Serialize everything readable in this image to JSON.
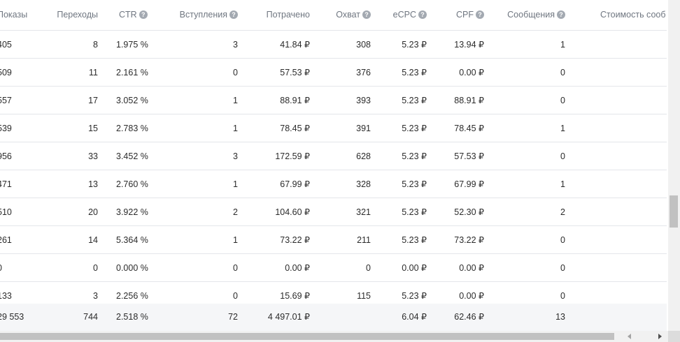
{
  "headers": {
    "shows": "Показы",
    "clicks": "Переходы",
    "ctr": "CTR",
    "joins": "Вступления",
    "spent": "Потрачено",
    "reach": "Охват",
    "ecpc": "eCPC",
    "cpf": "CPF",
    "messages": "Сообщения",
    "cost": "Стоимость сооб"
  },
  "help_icon": "question-circle-icon",
  "help_glyph": "?",
  "rows": [
    {
      "shows": "405",
      "clicks": "8",
      "ctr": "1.975 %",
      "joins": "3",
      "spent": "41.84 ₽",
      "reach": "308",
      "ecpc": "5.23 ₽",
      "cpf": "13.94 ₽",
      "messages": "1"
    },
    {
      "shows": "509",
      "clicks": "11",
      "ctr": "2.161 %",
      "joins": "0",
      "spent": "57.53 ₽",
      "reach": "376",
      "ecpc": "5.23 ₽",
      "cpf": "0.00 ₽",
      "messages": "0"
    },
    {
      "shows": "557",
      "clicks": "17",
      "ctr": "3.052 %",
      "joins": "1",
      "spent": "88.91 ₽",
      "reach": "393",
      "ecpc": "5.23 ₽",
      "cpf": "88.91 ₽",
      "messages": "0"
    },
    {
      "shows": "539",
      "clicks": "15",
      "ctr": "2.783 %",
      "joins": "1",
      "spent": "78.45 ₽",
      "reach": "391",
      "ecpc": "5.23 ₽",
      "cpf": "78.45 ₽",
      "messages": "1"
    },
    {
      "shows": "956",
      "clicks": "33",
      "ctr": "3.452 %",
      "joins": "3",
      "spent": "172.59 ₽",
      "reach": "628",
      "ecpc": "5.23 ₽",
      "cpf": "57.53 ₽",
      "messages": "0"
    },
    {
      "shows": "471",
      "clicks": "13",
      "ctr": "2.760 %",
      "joins": "1",
      "spent": "67.99 ₽",
      "reach": "328",
      "ecpc": "5.23 ₽",
      "cpf": "67.99 ₽",
      "messages": "1"
    },
    {
      "shows": "510",
      "clicks": "20",
      "ctr": "3.922 %",
      "joins": "2",
      "spent": "104.60 ₽",
      "reach": "321",
      "ecpc": "5.23 ₽",
      "cpf": "52.30 ₽",
      "messages": "2"
    },
    {
      "shows": "261",
      "clicks": "14",
      "ctr": "5.364 %",
      "joins": "1",
      "spent": "73.22 ₽",
      "reach": "211",
      "ecpc": "5.23 ₽",
      "cpf": "73.22 ₽",
      "messages": "0"
    },
    {
      "shows": "0",
      "clicks": "0",
      "ctr": "0.000 %",
      "joins": "0",
      "spent": "0.00 ₽",
      "reach": "0",
      "ecpc": "0.00 ₽",
      "cpf": "0.00 ₽",
      "messages": "0"
    },
    {
      "shows": "133",
      "clicks": "3",
      "ctr": "2.256 %",
      "joins": "0",
      "spent": "15.69 ₽",
      "reach": "115",
      "ecpc": "5.23 ₽",
      "cpf": "0.00 ₽",
      "messages": "0"
    }
  ],
  "totals": {
    "shows": "29 553",
    "clicks": "744",
    "ctr": "2.518 %",
    "joins": "72",
    "spent": "4 497.01 ₽",
    "reach": "",
    "ecpc": "6.04 ₽",
    "cpf": "62.46 ₽",
    "messages": "13"
  },
  "colors": {
    "header_text": "#6f7680",
    "body_text": "#2b2b2b",
    "row_border": "#e4e6ea",
    "footer_bg": "#f5f6f8",
    "help_icon_bg": "#a3a9b1"
  }
}
